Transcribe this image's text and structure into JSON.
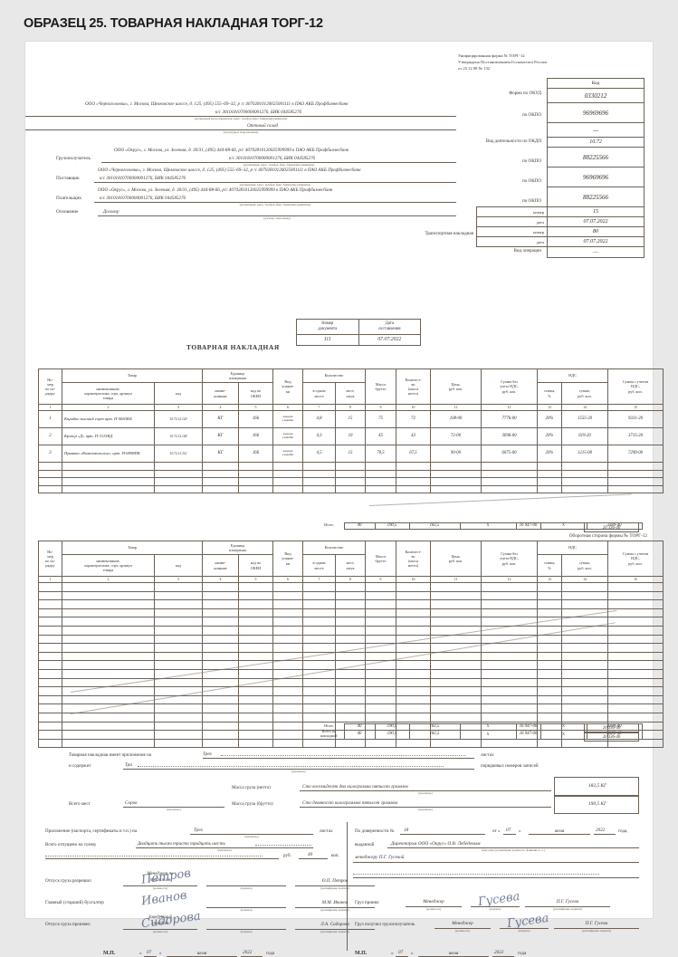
{
  "page_title": "ОБРАЗЕЦ 25. ТОВАРНАЯ НАКЛАДНАЯ ТОРГ-12",
  "form_header": {
    "line1": "Унифицированная форма № ТОРГ-12",
    "line2": "Утверждена Постановлением Госкомстата России",
    "line3": "от 25.12.98 № 132"
  },
  "code_block": {
    "header": "Код",
    "okud_label": "Форма по ОКУД",
    "okud_value": "0330212",
    "okpo_label": "по ОКПО",
    "shipper_okpo": "96969696",
    "subdivision_value": "—",
    "okdp_label": "Вид деятельности по ОКДП",
    "okdp_value": "10.72",
    "consignee_okpo": "88225566",
    "supplier_okpo": "96969696",
    "payer_okpo": "88225566",
    "number_label": "номер",
    "date_label": "дата",
    "basis_number": "15",
    "basis_date": "07.07.2022",
    "waybill_label": "Транспортная накладная",
    "waybill_number": "80",
    "waybill_date": "07.07.2022",
    "operation_label": "Вид операции",
    "operation_value": "—"
  },
  "parties": {
    "shipper": {
      "line1": "ООО «Черноголовка», г. Москва, Щелковское шоссе, д. 125, (495) 555–69–32, р /с 40702810120025001111 в ПАО АКБ Профбизнесбанк",
      "line2": "к/с 30101810700000001276, БИК 044585276",
      "hint": "(организация грузоотправитель, адрес, телефон, факс, банковские реквизиты)"
    },
    "subdivision": {
      "value": "Оптовый склад",
      "hint": "(структурное подразделение)"
    },
    "consignee": {
      "label": "Грузополучатель",
      "line1": "ООО «Округ», г. Москва, ул. Зеленая, д. 30/31, (495) 444-88-66, р/с 40702810120025999999 в ПАО АКБ Профбизнесбанк",
      "line2": "к/с 30101810700000001276, БИК 044585276",
      "hint": "(организация, адрес, телефон, факс, банковские реквизиты)"
    },
    "supplier": {
      "label": "Поставщик",
      "line1": "ООО «Черноголовка», г. Москва, Щелковское шоссе, д. 125, (495) 555–69–32, р /с 40702810120025001111 в ПАО АКБ Профбизнесбанк",
      "line2": "к/с 30101810700000001276, БИК 044585276",
      "hint": "(организация, адрес, телефон, факс, банковские реквизиты)"
    },
    "payer": {
      "label": "Плательщик",
      "line1": "ООО «Округ», г. Москва, ул. Зеленая, д. 30/31, (495) 444-88-66, р/с 40702810120025999999 в ПАО АКБ Профбизнесбанк",
      "line2": "к/с 30101810700000001276, БИК 044585276",
      "hint": "(организация, адрес, телефон, факс, банковские реквизиты)"
    },
    "basis": {
      "label": "Основание",
      "value": "Договор",
      "hint": "(договор, заказ-наряд)"
    }
  },
  "invoice_title": {
    "title": "ТОВАРНАЯ НАКЛАДНАЯ",
    "num_header_l1": "Номер",
    "num_header_l2": "документа",
    "date_header_l1": "Дата",
    "date_header_l2": "составления",
    "number": "111",
    "date": "07.07.2022"
  },
  "table": {
    "headers": {
      "c1_l1": "Но-",
      "c1_l2": "мер",
      "c1_l3": "по по-",
      "c1_l4": "рядку",
      "goods": "Товар",
      "goods_name_l1": "наименование,",
      "goods_name_l2": "характеристика, сорт, артикул",
      "goods_name_l3": "товара",
      "goods_code": "код",
      "unit": "Единица",
      "unit2": "измерения",
      "unit_name_l1": "наиме-",
      "unit_name_l2": "нование",
      "okei_l1": "код по",
      "okei_l2": "ОКЕИ",
      "pack_l1": "Вид",
      "pack_l2": "упаков-",
      "pack_l3": "ки",
      "qty": "Количество",
      "qty_one_l1": "в одном",
      "qty_one_l2": "месте",
      "qty_places_l1": "мест,",
      "qty_places_l2": "штук",
      "mass_gross_l1": "Масса",
      "mass_gross_l2": "брутто",
      "qty_net_l1": "Количест-",
      "qty_net_l2": "во",
      "qty_net_l3": "(масса",
      "qty_net_l4": "нетто)",
      "price_l1": "Цена,",
      "price_l2": "руб. коп.",
      "sum_wo_vat_l1": "Сумма без",
      "sum_wo_vat_l2": "учета НДС,",
      "sum_wo_vat_l3": "руб. коп.",
      "vat": "НДС",
      "vat_rate_l1": "ставка,",
      "vat_rate_l2": "%",
      "vat_sum_l1": "сумма,",
      "vat_sum_l2": "руб. коп.",
      "sum_with_vat_l1": "Сумма с учетом",
      "sum_with_vat_l2": "НДС,",
      "sum_with_vat_l3": "руб. коп."
    },
    "col_numbers": [
      "1",
      "2",
      "3",
      "4",
      "5",
      "6",
      "7",
      "8",
      "9",
      "10",
      "11",
      "12",
      "13",
      "14",
      "15"
    ],
    "rows": [
      {
        "no": "1",
        "name": "Карабье высший сорт арт. П-5663КБ",
        "code": "10.72.12.120",
        "unit": "КГ",
        "okei": "166",
        "pack_l1": "навалом",
        "pack_l2": "в коробке",
        "qty_one": "4,8",
        "places": "15",
        "mass_gross": "75",
        "qty_net": "72",
        "price": "108-00",
        "sum_wo_vat": "7776-00",
        "vat_rate": "20%",
        "vat_sum": "1555-20",
        "sum_with_vat": "9331-20"
      },
      {
        "no": "2",
        "name": "Крекер «Д» арт. П-3115КД",
        "code": "10.72.12.140",
        "unit": "КГ",
        "okei": "166",
        "pack_l1": "навалом",
        "pack_l2": "в коробке",
        "qty_one": "4,3",
        "places": "10",
        "mass_gross": "45",
        "qty_net": "43",
        "price": "72-00",
        "sum_wo_vat": "3096-00",
        "vat_rate": "20%",
        "vat_sum": "619-20",
        "sum_with_vat": "3715-20"
      },
      {
        "no": "3",
        "name": "Пряники «Комсомольские» арт. П-6998ПК",
        "code": "10.72.12.112",
        "unit": "КГ",
        "okei": "166",
        "pack_l1": "навалом",
        "pack_l2": "в коробке",
        "qty_one": "4,5",
        "places": "15",
        "mass_gross": "70,5",
        "qty_net": "67,5",
        "price": "90-00",
        "sum_wo_vat": "6075-00",
        "vat_rate": "20%",
        "vat_sum": "1215-00",
        "sum_with_vat": "7290-00"
      }
    ],
    "totals_label": "Итого",
    "grand_total_label": "Всего по накладной",
    "totals": {
      "places": "40",
      "mass_gross": "190,5",
      "qty_net": "182,5",
      "price": "X",
      "sum_wo_vat": "16 947-00",
      "vat_rate": "X",
      "vat_sum": "3389-40",
      "sum_with_vat": "20 336-40"
    },
    "backside_note": "Оборотная сторона формы № ТОРГ-12"
  },
  "footer": {
    "appendix_label": "Товарная накладная имеет приложение на",
    "appendix_value": "Трех",
    "appendix_unit": "листах",
    "contains_label": "и содержит",
    "contains_value": "Три",
    "contains_unit": "порядковых номеров записей",
    "hint_words": "(прописью)",
    "net_mass_label": "Масса груза (нетто)",
    "net_mass_words": "Сто восемьдесят два килограмма пятьсот граммов",
    "net_mass_value": "182,5 КГ",
    "places_label": "Всего мест",
    "places_value": "Сорок",
    "gross_mass_label": "Масса груза (брутто)",
    "gross_mass_words": "Сто девяносто килограммов пятьсот граммов",
    "gross_mass_value": "190,5 КГ",
    "attachment_label": "Приложение (паспорта, сертификаты и т.п.) на",
    "attachment_value": "Трех",
    "attachment_unit": "листах",
    "released_label": "Всего отпущено на сумму",
    "released_words": "Двадцать тысяч триста тридцать шесть",
    "rub_label": "руб.",
    "kop_value": "40",
    "kop_label": "коп.",
    "proxy_label": "По доверенности №",
    "proxy_number": "18",
    "proxy_from": "от «",
    "proxy_day": "07",
    "proxy_quote": "»",
    "proxy_month": "июля",
    "proxy_year": "2022",
    "proxy_year_suffix": "года,",
    "issued_label": "выданной",
    "issued_value": "Директором ООО «Округ» О.В. Лебедевым",
    "issued_hint": "(кем, кому (организация, должность, фамилия, и., о.)",
    "issued_to": "менеджеру П.Г. Гусевой"
  },
  "signatures": {
    "hint_position": "(должность)",
    "hint_signature": "(подпись)",
    "hint_name": "(расшифровка подписи)",
    "left": [
      {
        "role": "Отпуск груза разрешил",
        "position_l1": "Менеджер по",
        "position_l2": "продажам",
        "name": "О.П. Петров",
        "glyph": "Петров"
      },
      {
        "role": "Главный (старший) бухгалтер",
        "position_l1": "",
        "position_l2": "",
        "name": "М.М. Иванов",
        "glyph": "Иванов"
      },
      {
        "role": "Отпуск груза произвел",
        "position_l1": "Заведующий",
        "position_l2": "складом",
        "name": "Л.А. Сидорова",
        "glyph": "Сидорова"
      }
    ],
    "right": [
      {
        "role": "Груз принял",
        "position": "Менеджер",
        "name": "П.Г. Гусева",
        "glyph": "Гусева"
      },
      {
        "role": "Груз получил грузополучатель",
        "position": "Менеджер",
        "name": "П.Г. Гусева",
        "glyph": "Гусева"
      }
    ],
    "stamp_label": "М.П.",
    "date_quote_open": "«",
    "date_day": "07",
    "date_quote_close": "»",
    "date_month": "июля",
    "date_year": "2022",
    "date_suffix": "года"
  }
}
